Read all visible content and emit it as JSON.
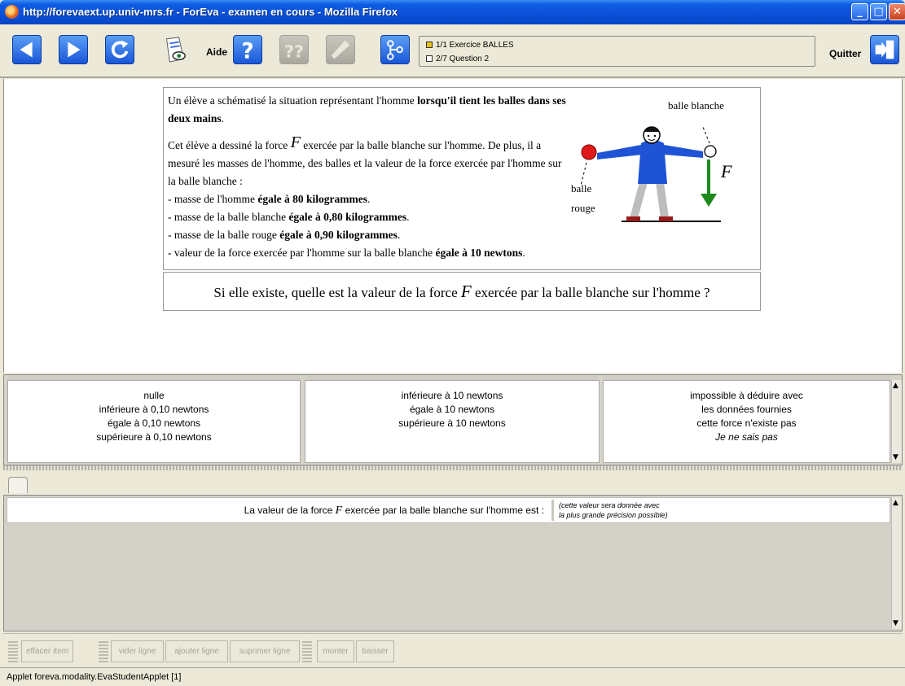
{
  "window": {
    "title": "http://forevaext.up.univ-mrs.fr - ForEva - examen en cours - Mozilla Firefox"
  },
  "toolbar": {
    "aide_label": "Aide",
    "quit_label": "Quitter",
    "exercise_line": "1/1  Exercice BALLES",
    "question_line": "2/7  Question 2"
  },
  "statement": {
    "p1_a": "Un élève a schématisé la situation représentant l'homme ",
    "p1_b": "lorsqu'il tient les balles dans ses deux mains",
    "p1_c": ".",
    "p2_a": "Cet élève a dessiné la force ",
    "p2_b": " exercée par la balle blanche sur l'homme. De plus, il a mesuré les masses de l'homme, des balles et la valeur de la force exercée par l'homme sur la balle blanche :",
    "m1_a": "- masse de l'homme ",
    "m1_b": "égale à 80 kilogrammes",
    "m2_a": "- masse de la balle blanche ",
    "m2_b": "égale à 0,80 kilogrammes",
    "m3_a": "- masse de la balle rouge ",
    "m3_b": "égale à 0,90 kilogrammes",
    "m4_a": "- valeur de la force exercée par l'homme sur la balle blanche ",
    "m4_b": "égale à 10 newtons",
    "dot": ".",
    "force_symbol": "F"
  },
  "figure": {
    "label_white_ball": "balle blanche",
    "label_red_ball_1": "balle",
    "label_red_ball_2": "rouge",
    "force_label": "F"
  },
  "question": {
    "prompt_a": "Si elle existe, quelle est la valeur de la force ",
    "prompt_b": " exercée par la balle blanche sur l'homme ?"
  },
  "choices": {
    "col1": [
      "nulle",
      "inférieure à 0,10 newtons",
      "égale à 0,10 newtons",
      "supérieure à 0,10 newtons"
    ],
    "col2": [
      "inférieure à 10 newtons",
      "égale à 10 newtons",
      "supérieure à 10 newtons"
    ],
    "col3": [
      "impossible à déduire avec",
      "les données fournies",
      "cette force n'existe pas",
      "Je ne sais pas"
    ]
  },
  "answer": {
    "label_a": "La valeur de la force ",
    "label_b": " exercée par la balle blanche sur l'homme est :",
    "placeholder_1": "(cette valeur sera donnée avec",
    "placeholder_2": "la plus grande précision possible)"
  },
  "actions": {
    "clear_item": "effacer item",
    "empty_line": "vider ligne",
    "add_line": "ajouter ligne",
    "delete_line": "suprimer ligne",
    "up": "monter",
    "down": "baisser"
  },
  "status": {
    "text": "Applet foreva.modality.EvaStudentApplet [1]"
  }
}
